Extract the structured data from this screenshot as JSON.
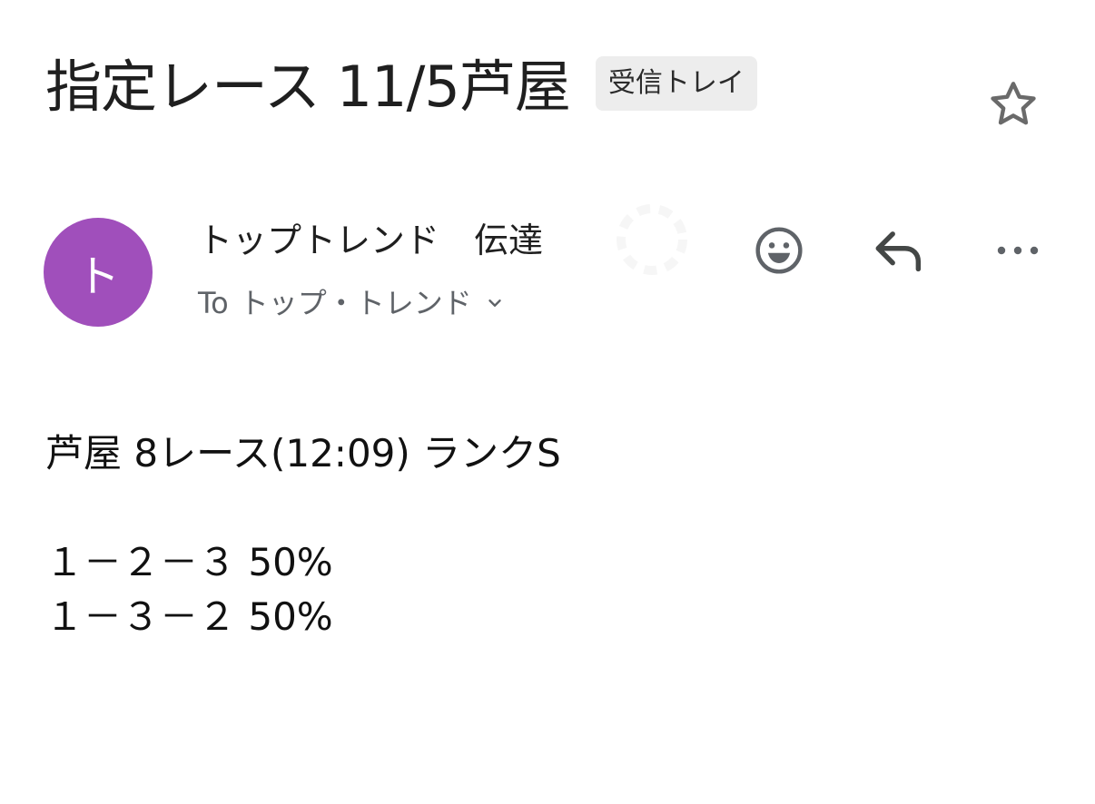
{
  "email": {
    "subject": "指定レース 11/5芦屋",
    "label_chip": "受信トレイ",
    "sender": {
      "avatar_letter": "ト",
      "avatar_color": "#a04fbb",
      "name": "トップトレンド　伝達"
    },
    "recipient": {
      "prefix": "To",
      "name": "トップ・トレンド"
    },
    "body": {
      "heading": "芦屋 8レース(12:09) ランクS",
      "lines": [
        "１－２－３ 50%",
        "１－３－２ 50%"
      ]
    }
  },
  "icons": {
    "star": "star-outline-icon",
    "emoji": "emoji-reaction-icon",
    "reply": "reply-icon",
    "more": "more-horizontal-icon",
    "expand": "chevron-down-icon"
  },
  "colors": {
    "icon": "#5f6368",
    "chip_bg": "#ededed"
  }
}
